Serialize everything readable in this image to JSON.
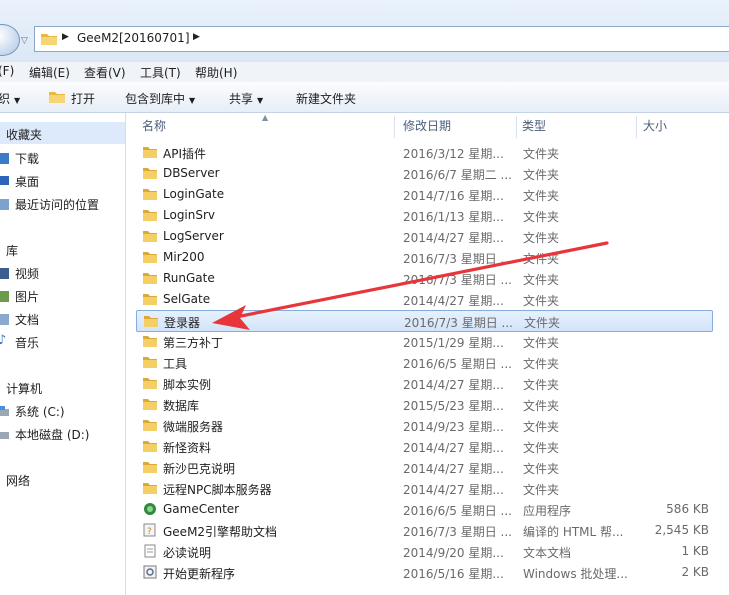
{
  "address": {
    "path": "GeeM2[20160701]"
  },
  "menu": [
    {
      "label": "(F)"
    },
    {
      "label": "编辑(E)"
    },
    {
      "label": "查看(V)"
    },
    {
      "label": "工具(T)"
    },
    {
      "label": "帮助(H)"
    }
  ],
  "toolbar": {
    "organize_label": "织",
    "open_label": "打开",
    "include_label": "包含到库中",
    "share_label": "共享",
    "new_folder_label": "新建文件夹"
  },
  "nav": {
    "favorites": "收藏夹",
    "downloads": "下载",
    "desktop": "桌面",
    "recent": "最近访问的位置",
    "libraries": "库",
    "videos": "视频",
    "pictures": "图片",
    "documents": "文档",
    "music": "音乐",
    "computer": "计算机",
    "drive_c": "系统 (C:)",
    "drive_d": "本地磁盘 (D:)",
    "network": "网络"
  },
  "columns": {
    "name": "名称",
    "date": "修改日期",
    "type": "类型",
    "size": "大小"
  },
  "files": [
    {
      "name": "API插件",
      "date": "2016/3/12 星期...",
      "type": "文件夹",
      "size": "",
      "icon": "folder-icon"
    },
    {
      "name": "DBServer",
      "date": "2016/6/7 星期二 ...",
      "type": "文件夹",
      "size": "",
      "icon": "folder-icon"
    },
    {
      "name": "LoginGate",
      "date": "2014/7/16 星期...",
      "type": "文件夹",
      "size": "",
      "icon": "folder-icon"
    },
    {
      "name": "LoginSrv",
      "date": "2016/1/13 星期...",
      "type": "文件夹",
      "size": "",
      "icon": "folder-icon"
    },
    {
      "name": "LogServer",
      "date": "2014/4/27 星期...",
      "type": "文件夹",
      "size": "",
      "icon": "folder-icon"
    },
    {
      "name": "Mir200",
      "date": "2016/7/3 星期日 ...",
      "type": "文件夹",
      "size": "",
      "icon": "folder-icon"
    },
    {
      "name": "RunGate",
      "date": "2016/7/3 星期日 ...",
      "type": "文件夹",
      "size": "",
      "icon": "folder-icon"
    },
    {
      "name": "SelGate",
      "date": "2014/4/27 星期...",
      "type": "文件夹",
      "size": "",
      "icon": "folder-icon"
    },
    {
      "name": "登录器",
      "date": "2016/7/3 星期日 ...",
      "type": "文件夹",
      "size": "",
      "icon": "folder-icon",
      "selected": true
    },
    {
      "name": "第三方补丁",
      "date": "2015/1/29 星期...",
      "type": "文件夹",
      "size": "",
      "icon": "folder-icon"
    },
    {
      "name": "工具",
      "date": "2016/6/5 星期日 ...",
      "type": "文件夹",
      "size": "",
      "icon": "folder-icon"
    },
    {
      "name": "脚本实例",
      "date": "2014/4/27 星期...",
      "type": "文件夹",
      "size": "",
      "icon": "folder-icon"
    },
    {
      "name": "数据库",
      "date": "2015/5/23 星期...",
      "type": "文件夹",
      "size": "",
      "icon": "folder-icon"
    },
    {
      "name": "微端服务器",
      "date": "2014/9/23 星期...",
      "type": "文件夹",
      "size": "",
      "icon": "folder-icon"
    },
    {
      "name": "新怪资料",
      "date": "2014/4/27 星期...",
      "type": "文件夹",
      "size": "",
      "icon": "folder-icon"
    },
    {
      "name": "新沙巴克说明",
      "date": "2014/4/27 星期...",
      "type": "文件夹",
      "size": "",
      "icon": "folder-icon"
    },
    {
      "name": "远程NPC脚本服务器",
      "date": "2014/4/27 星期...",
      "type": "文件夹",
      "size": "",
      "icon": "folder-icon"
    },
    {
      "name": "GameCenter",
      "date": "2016/6/5 星期日 ...",
      "type": "应用程序",
      "size": "586 KB",
      "icon": "app-icon"
    },
    {
      "name": "GeeM2引擎帮助文档",
      "date": "2016/7/3 星期日 ...",
      "type": "编译的 HTML 帮...",
      "size": "2,545 KB",
      "icon": "help-icon"
    },
    {
      "name": "必读说明",
      "date": "2014/9/20 星期...",
      "type": "文本文档",
      "size": "1 KB",
      "icon": "text-file-icon"
    },
    {
      "name": "开始更新程序",
      "date": "2016/5/16 星期...",
      "type": "Windows 批处理...",
      "size": "2 KB",
      "icon": "batch-file-icon"
    }
  ],
  "colors": {
    "selection": "#d2e4fa",
    "arrow": "#e8353a",
    "folder": "#f0c64e"
  }
}
